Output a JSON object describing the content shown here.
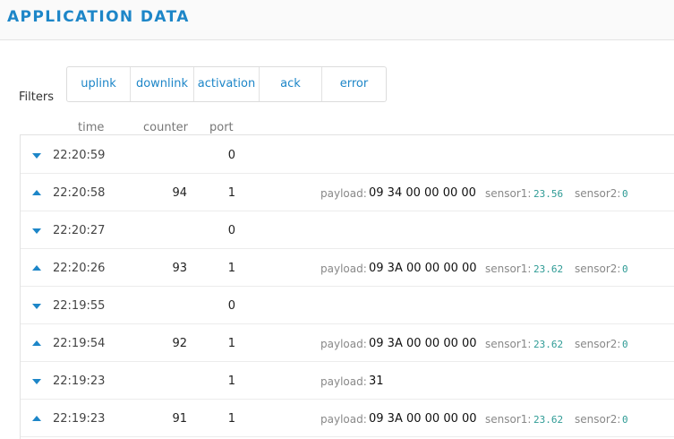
{
  "header": {
    "title": "APPLICATION DATA"
  },
  "filters": {
    "label": "Filters",
    "buttons": [
      "uplink",
      "downlink",
      "activation",
      "ack",
      "error"
    ]
  },
  "columns": {
    "time": "time",
    "counter": "counter",
    "port": "port"
  },
  "rows": [
    {
      "expanded": false,
      "time": "22:20:59",
      "counter": "",
      "port": "0",
      "payload_label": "",
      "payload": "",
      "sensor1_label": "",
      "sensor1": "",
      "sensor2_label": "",
      "sensor2": ""
    },
    {
      "expanded": true,
      "time": "22:20:58",
      "counter": "94",
      "port": "1",
      "payload_label": "payload:",
      "payload": "09 34 00 00 00 00",
      "sensor1_label": "sensor1:",
      "sensor1": "23.56",
      "sensor2_label": "sensor2:",
      "sensor2": "0"
    },
    {
      "expanded": false,
      "time": "22:20:27",
      "counter": "",
      "port": "0",
      "payload_label": "",
      "payload": "",
      "sensor1_label": "",
      "sensor1": "",
      "sensor2_label": "",
      "sensor2": ""
    },
    {
      "expanded": true,
      "time": "22:20:26",
      "counter": "93",
      "port": "1",
      "payload_label": "payload:",
      "payload": "09 3A 00 00 00 00",
      "sensor1_label": "sensor1:",
      "sensor1": "23.62",
      "sensor2_label": "sensor2:",
      "sensor2": "0"
    },
    {
      "expanded": false,
      "time": "22:19:55",
      "counter": "",
      "port": "0",
      "payload_label": "",
      "payload": "",
      "sensor1_label": "",
      "sensor1": "",
      "sensor2_label": "",
      "sensor2": ""
    },
    {
      "expanded": true,
      "time": "22:19:54",
      "counter": "92",
      "port": "1",
      "payload_label": "payload:",
      "payload": "09 3A 00 00 00 00",
      "sensor1_label": "sensor1:",
      "sensor1": "23.62",
      "sensor2_label": "sensor2:",
      "sensor2": "0"
    },
    {
      "expanded": false,
      "time": "22:19:23",
      "counter": "",
      "port": "1",
      "payload_label": "payload:",
      "payload": "31",
      "sensor1_label": "",
      "sensor1": "",
      "sensor2_label": "",
      "sensor2": ""
    },
    {
      "expanded": true,
      "time": "22:19:23",
      "counter": "91",
      "port": "1",
      "payload_label": "payload:",
      "payload": "09 3A 00 00 00 00",
      "sensor1_label": "sensor1:",
      "sensor1": "23.62",
      "sensor2_label": "sensor2:",
      "sensor2": "0"
    }
  ],
  "colors": {
    "accent": "#1d86c8",
    "sensor_value": "#2e9b95"
  },
  "icons": {
    "collapsed": "triangle-down-icon",
    "expanded": "triangle-up-icon"
  }
}
